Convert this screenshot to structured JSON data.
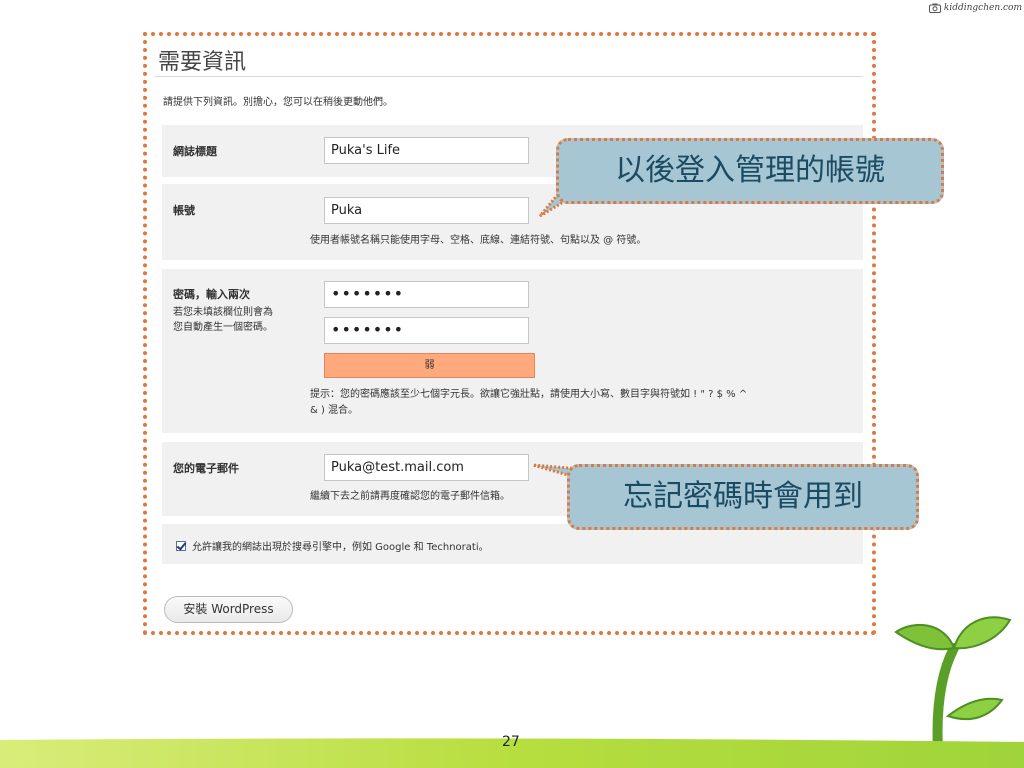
{
  "brand": "kiddingchen.com",
  "title": "需要資訊",
  "intro": "請提供下列資訊。別擔心，您可以在稍後更動他們。",
  "fields": {
    "blog_title": {
      "label": "網誌標題",
      "value": "Puka's Life"
    },
    "username": {
      "label": "帳號",
      "value": "Puka",
      "hint": "使用者帳號名稱只能使用字母、空格、底線、連結符號、句點以及 @ 符號。"
    },
    "password": {
      "label": "密碼，輸入兩次",
      "sub_line1": "若您未填該欄位則會為",
      "sub_line2": "您自動產生一個密碼。",
      "value1": "•••••••",
      "value2": "•••••••",
      "strength": "弱",
      "hint_line1": "提示：您的密碼應該至少七個字元長。欲讓它強壯點，請使用大小寫、數目字與符號如 ! \" ? $ % ^",
      "hint_line2": "& ) 混合。"
    },
    "email": {
      "label": "您的電子郵件",
      "value": "Puka@test.mail.com",
      "hint": "繼續下去之前請再度確認您的電子郵件信箱。"
    }
  },
  "privacy_checkbox": {
    "label": "允許讓我的網誌出現於搜尋引擎中，例如 Google 和 Technorati。",
    "checked": true
  },
  "install_button": "安裝 WordPress",
  "callouts": {
    "account": "以後登入管理的帳號",
    "password": "忘記密碼時會用到"
  },
  "page_number": "27",
  "colors": {
    "frame": "#e0773c",
    "callout_fill": "#a6c6d3",
    "strength_weak": "#ffa97c",
    "bar_green": "#9fd43a"
  }
}
